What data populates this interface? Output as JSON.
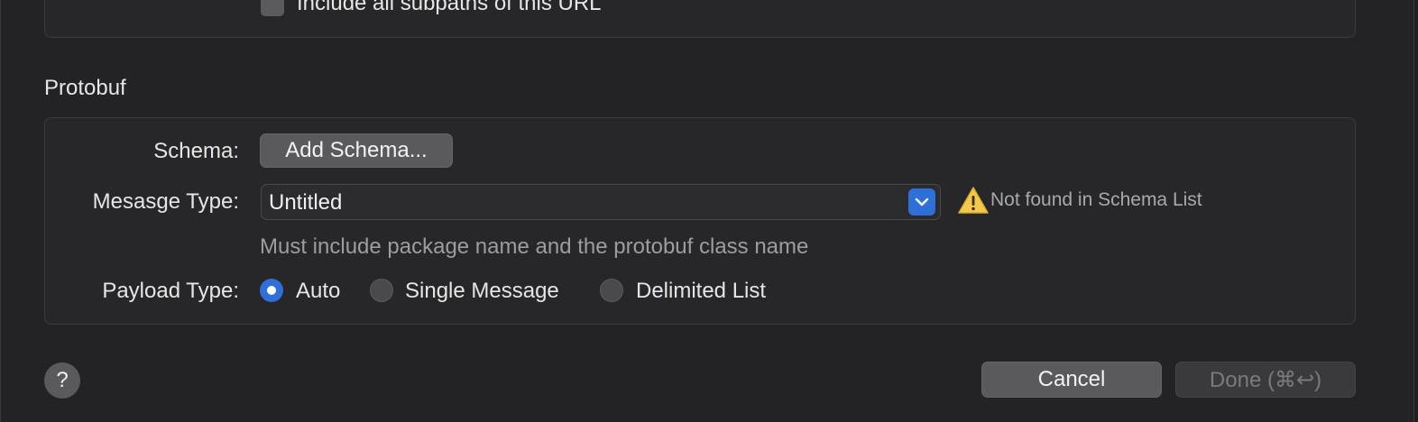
{
  "top_option": {
    "label": "Include all subpaths of this URL",
    "checked": false
  },
  "section": {
    "title": "Protobuf"
  },
  "schema": {
    "label": "Schema:",
    "button_label": "Add Schema..."
  },
  "message_type": {
    "label": "Mesasge Type:",
    "value": "Untitled",
    "warning": "Not found in Schema List",
    "hint": "Must include package name and the protobuf class name"
  },
  "payload_type": {
    "label": "Payload Type:",
    "options": [
      {
        "label": "Auto",
        "selected": true
      },
      {
        "label": "Single Message",
        "selected": false
      },
      {
        "label": "Delimited List",
        "selected": false
      }
    ]
  },
  "footer": {
    "help_label": "?",
    "cancel_label": "Cancel",
    "done_label": "Done (⌘↩)"
  },
  "colors": {
    "accent": "#2f6fd8",
    "warning": "#f2c94c",
    "background": "#232325"
  }
}
